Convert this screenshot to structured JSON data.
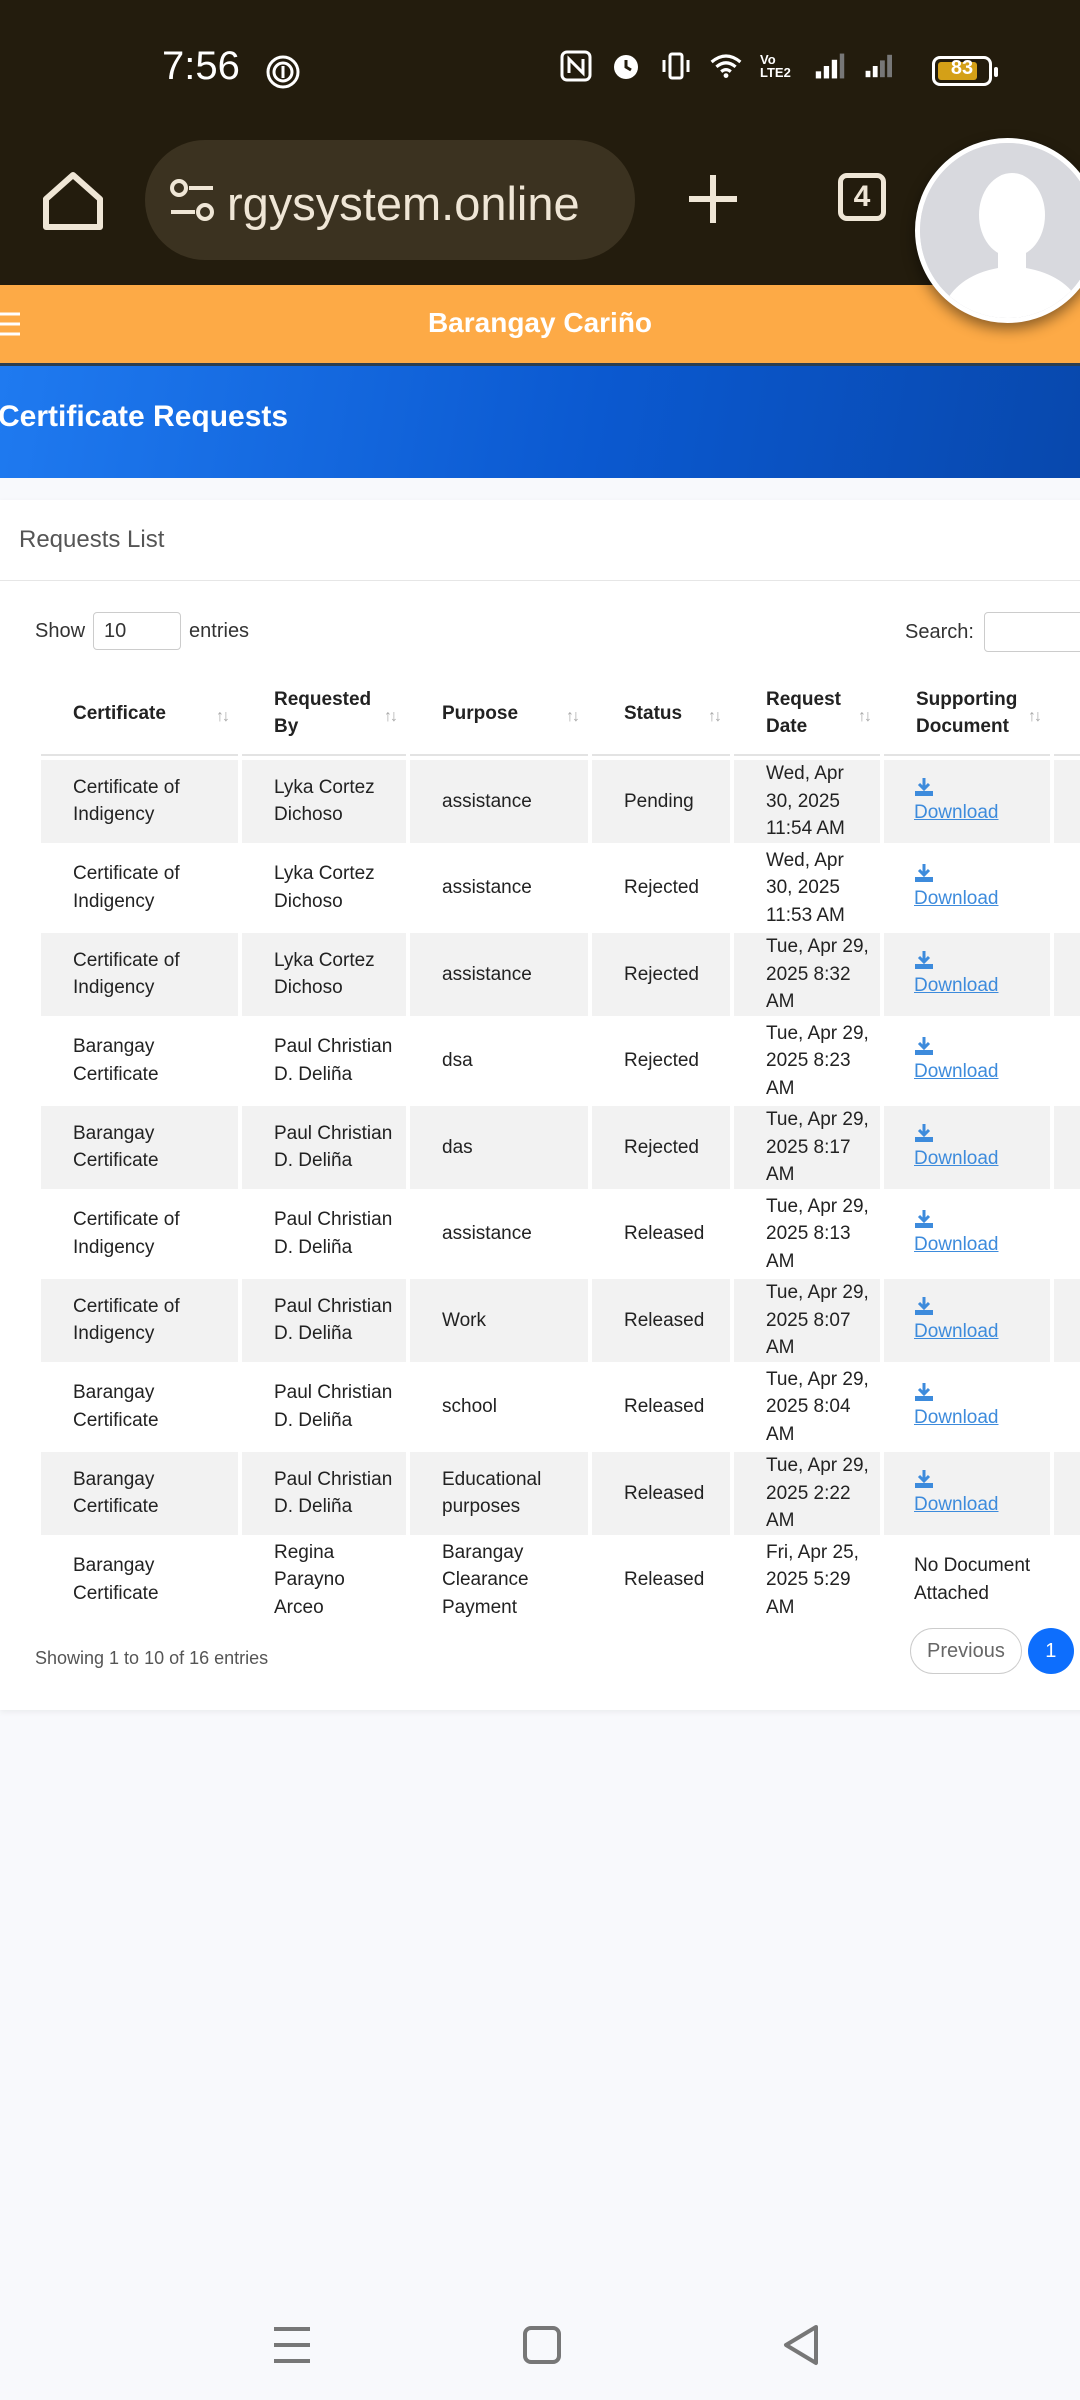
{
  "status_bar": {
    "time": "7:56",
    "battery": "83",
    "icons": [
      "fingerprint-icon",
      "nfc-icon",
      "alarm-icon",
      "vibrate-icon",
      "wifi-icon",
      "volte-icon",
      "signal-icon",
      "signal-2-icon"
    ],
    "volte_label": "Vo LTE2"
  },
  "browser": {
    "url": "rgysystem.online",
    "tab_count": "4"
  },
  "site": {
    "brand": "Barangay Cariño"
  },
  "page": {
    "title": "Certificate Requests"
  },
  "card": {
    "title": "Requests List",
    "show_label": "Show",
    "entries_value": "10",
    "entries_label": "entries",
    "search_label": "Search:",
    "search_value": ""
  },
  "table": {
    "headers": [
      "Certificate",
      "Requested By",
      "Purpose",
      "Status",
      "Request Date",
      "Supporting Document"
    ],
    "sort_glyph": "↑↓",
    "rows": [
      {
        "certificate": "Certificate of Indigency",
        "requested_by": "Lyka Cortez Dichoso",
        "purpose": "assistance",
        "status": "Pending",
        "date": "Wed, Apr 30, 2025 11:54 AM",
        "document": "Download"
      },
      {
        "certificate": "Certificate of Indigency",
        "requested_by": "Lyka Cortez Dichoso",
        "purpose": "assistance",
        "status": "Rejected",
        "date": "Wed, Apr 30, 2025 11:53 AM",
        "document": "Download"
      },
      {
        "certificate": "Certificate of Indigency",
        "requested_by": "Lyka Cortez Dichoso",
        "purpose": "assistance",
        "status": "Rejected",
        "date": "Tue, Apr 29, 2025 8:32 AM",
        "document": "Download"
      },
      {
        "certificate": "Barangay Certificate",
        "requested_by": "Paul Christian D. Deliña",
        "purpose": "dsa",
        "status": "Rejected",
        "date": "Tue, Apr 29, 2025 8:23 AM",
        "document": "Download"
      },
      {
        "certificate": "Barangay Certificate",
        "requested_by": "Paul Christian D. Deliña",
        "purpose": "das",
        "status": "Rejected",
        "date": "Tue, Apr 29, 2025 8:17 AM",
        "document": "Download"
      },
      {
        "certificate": "Certificate of Indigency",
        "requested_by": "Paul Christian D. Deliña",
        "purpose": "assistance",
        "status": "Released",
        "date": "Tue, Apr 29, 2025 8:13 AM",
        "document": "Download"
      },
      {
        "certificate": "Certificate of Indigency",
        "requested_by": "Paul Christian D. Deliña",
        "purpose": "Work",
        "status": "Released",
        "date": "Tue, Apr 29, 2025 8:07 AM",
        "document": "Download"
      },
      {
        "certificate": "Barangay Certificate",
        "requested_by": "Paul Christian D. Deliña",
        "purpose": "school",
        "status": "Released",
        "date": "Tue, Apr 29, 2025 8:04 AM",
        "document": "Download"
      },
      {
        "certificate": "Barangay Certificate",
        "requested_by": "Paul Christian D. Deliña",
        "purpose": "Educational purposes",
        "status": "Released",
        "date": "Tue, Apr 29, 2025 2:22 AM",
        "document": "Download"
      },
      {
        "certificate": "Barangay Certificate",
        "requested_by": "Regina Parayno Arceo",
        "purpose": "Barangay Clearance Payment",
        "status": "Released",
        "date": "Fri, Apr 25, 2025 5:29 AM",
        "document": "No Document Attached"
      }
    ],
    "info": "Showing 1 to 10 of 16 entries",
    "prev_label": "Previous",
    "current_page": "1"
  },
  "colors": {
    "status_bar": "#231c0d",
    "navbar": "#fdaa46",
    "header_blue": "#1565d8",
    "link": "#3d8bdc",
    "page_active": "#0d6efd"
  }
}
